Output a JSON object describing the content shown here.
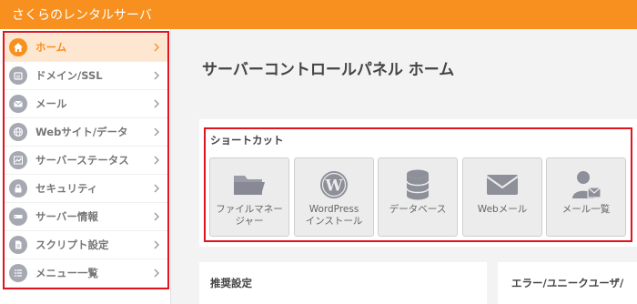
{
  "header": {
    "brand": "さくらのレンタルサーバ"
  },
  "sidebar": {
    "items": [
      {
        "label": "ホーム",
        "icon": "home-icon",
        "active": true
      },
      {
        "label": "ドメイン/SSL",
        "icon": "domain-icon"
      },
      {
        "label": "メール",
        "icon": "mail-icon"
      },
      {
        "label": "Webサイト/データ",
        "icon": "globe-icon"
      },
      {
        "label": "サーバーステータス",
        "icon": "chart-icon"
      },
      {
        "label": "セキュリティ",
        "icon": "lock-icon"
      },
      {
        "label": "サーバー情報",
        "icon": "server-icon"
      },
      {
        "label": "スクリプト設定",
        "icon": "script-icon"
      },
      {
        "label": "メニュー一覧",
        "icon": "list-icon"
      }
    ]
  },
  "main": {
    "title": "サーバーコントロールパネル ホーム",
    "shortcut": {
      "title": "ショートカット",
      "buttons": [
        {
          "line1": "ファイルマネー",
          "line2": "ジャー",
          "icon": "folder-icon"
        },
        {
          "line1": "WordPress",
          "line2": "インストール",
          "icon": "wordpress-icon"
        },
        {
          "line1": "データベース",
          "line2": "",
          "icon": "database-icon"
        },
        {
          "line1": "Webメール",
          "line2": "",
          "icon": "envelope-icon"
        },
        {
          "line1": "メール一覧",
          "line2": "",
          "icon": "user-mail-icon"
        }
      ]
    },
    "recommend": {
      "title": "推奨設定"
    },
    "errors": {
      "title": "エラー/ユニークユーザ/"
    }
  },
  "colors": {
    "brand": "#f7901e",
    "highlight": "#e0141e",
    "active_bg": "#fde7d1"
  }
}
